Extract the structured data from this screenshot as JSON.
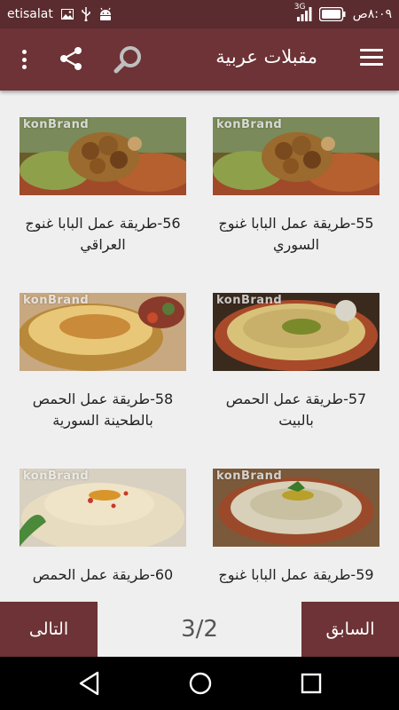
{
  "status_bar": {
    "carrier": "etisalat",
    "network": "3G",
    "time": "٨:٠٩ص",
    "icons": [
      "image-icon",
      "usb-icon",
      "android-debug-icon",
      "signal-icon",
      "battery-icon"
    ]
  },
  "app_bar": {
    "title": "مقبلات عربية",
    "icons": [
      "menu-icon",
      "search-icon",
      "share-icon",
      "more-vert-icon"
    ]
  },
  "watermark": "konBrand",
  "recipes": [
    {
      "title": "55-طريقة عمل البابا غنوج السوري",
      "image": "walnut-dip-photo"
    },
    {
      "title": "56-طريقة عمل البابا غنوج العراقي",
      "image": "walnut-dip-photo"
    },
    {
      "title": "57-طريقة عمل الحمص بالبيت",
      "image": "hummus-plate-photo"
    },
    {
      "title": "58-طريقة عمل الحمص بالطحينة السورية",
      "image": "hummus-tahini-photo"
    },
    {
      "title": "59-طريقة عمل البابا غنوج",
      "image": "baba-ghanoush-photo"
    },
    {
      "title": "60-طريقة عمل الحمص",
      "image": "hummus-paprika-photo"
    }
  ],
  "pager": {
    "prev_label": "السابق",
    "next_label": "التالى",
    "page_indicator": "3/2"
  },
  "nav_bar": {
    "icons": [
      "back-icon",
      "home-icon",
      "recents-icon"
    ]
  },
  "colors": {
    "status_bar": "#5a2c2f",
    "app_bar": "#6d3336",
    "background": "#efefef",
    "nav_bar": "#000000"
  }
}
